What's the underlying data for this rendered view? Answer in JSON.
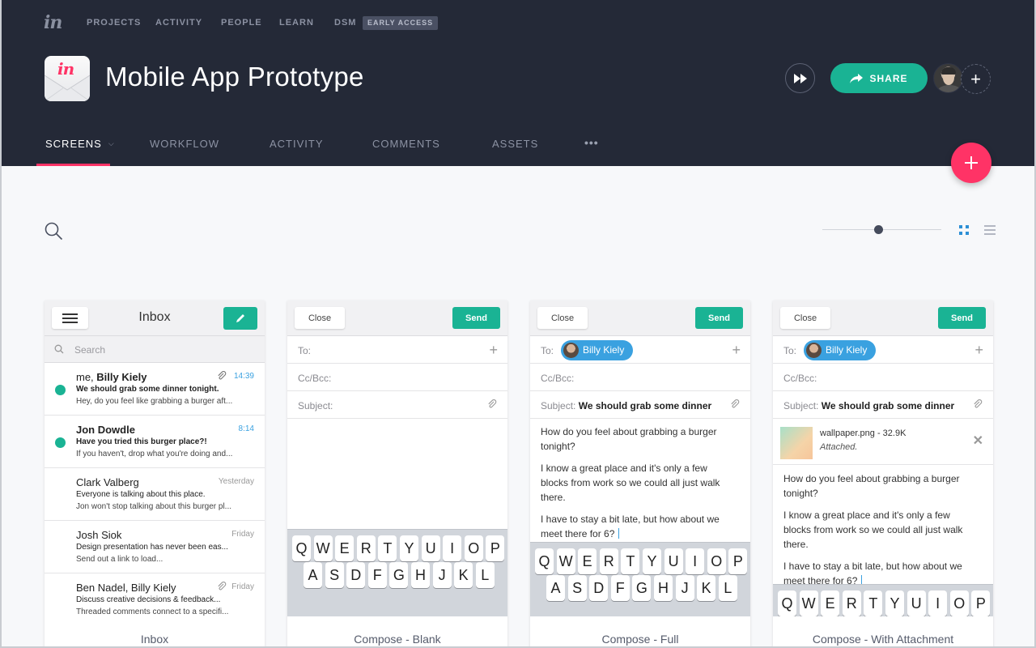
{
  "topnav": {
    "logo": "in",
    "items": [
      "PROJECTS",
      "ACTIVITY",
      "PEOPLE",
      "LEARN",
      "DSM"
    ],
    "badge": "EARLY ACCESS"
  },
  "project": {
    "icon_text": "in",
    "title": "Mobile App Prototype"
  },
  "actions": {
    "share_label": "SHARE",
    "accent_color": "#1ab394"
  },
  "tabs": [
    {
      "label": "SCREENS",
      "active": true
    },
    {
      "label": "WORKFLOW",
      "active": false
    },
    {
      "label": "ACTIVITY",
      "active": false
    },
    {
      "label": "COMMENTS",
      "active": false
    },
    {
      "label": "ASSETS",
      "active": false
    }
  ],
  "more_label": "•••",
  "fab_color": "#ff3366",
  "zoom_level": 0.44,
  "cards": [
    {
      "caption": "Inbox",
      "title": "Inbox",
      "search_placeholder": "Search",
      "emails": [
        {
          "from_prefix": "me, ",
          "from_name": "Billy Kiely",
          "time": "14:39",
          "subject": "We should grab some dinner tonight.",
          "preview": "Hey, do you feel like grabbing a burger aft...",
          "unread": true
        },
        {
          "from_prefix": "",
          "from_name": "Jon Dowdle",
          "time": "8:14",
          "subject": "Have you tried this burger place?!",
          "preview": "If you haven't, drop what you're doing and...",
          "unread": true
        },
        {
          "from_prefix": "Clark Valberg",
          "from_name": "",
          "time": "Yesterday",
          "subject": "Everyone is talking about this place.",
          "preview": "Jon won't stop talking about this burger pl...",
          "unread": false
        },
        {
          "from_prefix": "Josh Siok",
          "from_name": "",
          "time": "Friday",
          "subject": "Design presentation has never been eas...",
          "preview": "Send out a link to load...",
          "unread": false
        },
        {
          "from_prefix": "Ben Nadel, Billy Kiely",
          "from_name": "",
          "time": "Friday",
          "subject": "Discuss creative decisions & feedback...",
          "preview": "Threaded comments connect to a specifi...",
          "unread": false
        }
      ]
    },
    {
      "caption": "Compose - Blank",
      "close_label": "Close",
      "send_label": "Send",
      "to_label": "To:",
      "cc_label": "Cc/Bcc:",
      "subject_label": "Subject:"
    },
    {
      "caption": "Compose - Full",
      "close_label": "Close",
      "send_label": "Send",
      "to_label": "To:",
      "recipient": "Billy Kiely",
      "cc_label": "Cc/Bcc:",
      "subject_label": "Subject:",
      "subject_value": "We should grab some dinner",
      "body": [
        "How do you feel about grabbing a burger tonight?",
        "I know a great place and it's only a few blocks from work so we could all just walk there.",
        "I have to stay a bit late, but how about we meet there for 6?"
      ]
    },
    {
      "caption": "Compose - With Attachment",
      "close_label": "Close",
      "send_label": "Send",
      "to_label": "To:",
      "recipient": "Billy Kiely",
      "cc_label": "Cc/Bcc:",
      "subject_label": "Subject:",
      "subject_value": "We should grab some dinner",
      "attachment_name": "wallpaper.png - 32.9K",
      "attachment_status": "Attached.",
      "body": [
        "How do you feel about grabbing a burger tonight?",
        "I know a great place and it's only a few blocks from work so we could all just walk there.",
        "I have to stay a bit late, but how about we meet there for 6?"
      ]
    }
  ],
  "keyboard": {
    "row1": [
      "Q",
      "W",
      "E",
      "R",
      "T",
      "Y",
      "U",
      "I",
      "O",
      "P"
    ],
    "row2": [
      "A",
      "S",
      "D",
      "F",
      "G",
      "H",
      "J",
      "K",
      "L"
    ]
  }
}
